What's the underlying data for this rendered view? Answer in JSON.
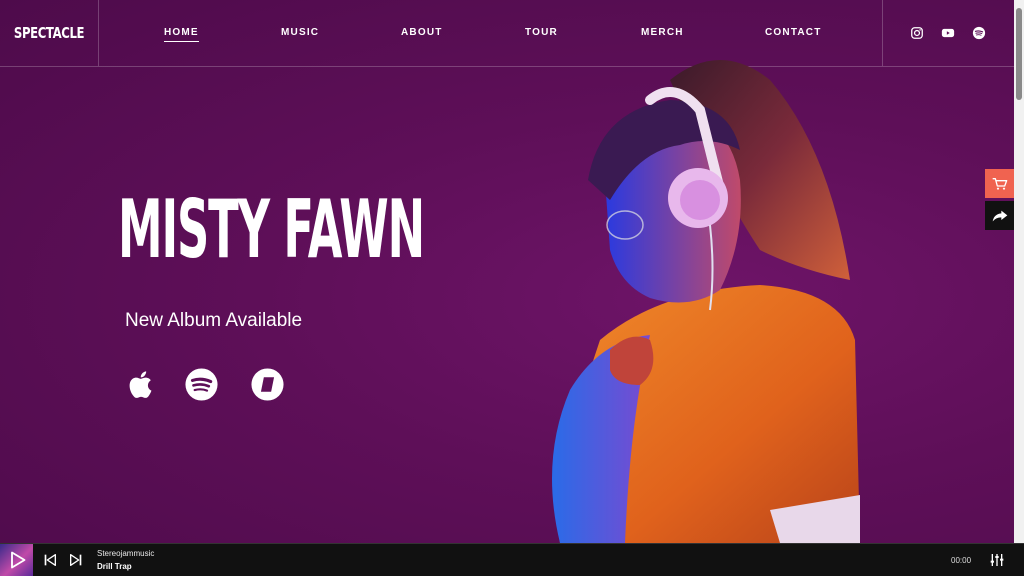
{
  "brand": {
    "logo": "SPECTACLE"
  },
  "nav": {
    "items": [
      {
        "label": "HOME",
        "active": true
      },
      {
        "label": "MUSIC"
      },
      {
        "label": "ABOUT"
      },
      {
        "label": "TOUR"
      },
      {
        "label": "MERCH"
      },
      {
        "label": "CONTACT"
      }
    ]
  },
  "social": [
    "instagram-icon",
    "youtube-icon",
    "spotify-icon"
  ],
  "hero": {
    "title": "MISTY FAWN",
    "subtitle": "New Album Available",
    "streaming": [
      "apple-music-icon",
      "spotify-icon",
      "deezer-icon"
    ]
  },
  "side": {
    "cart": "cart-icon",
    "share": "share-icon"
  },
  "player": {
    "artist": "Stereojammusic",
    "track": "Drill Trap",
    "time": "00:00"
  },
  "colors": {
    "background": "#5e0f58",
    "cart": "#f06350",
    "player": "#111111"
  }
}
